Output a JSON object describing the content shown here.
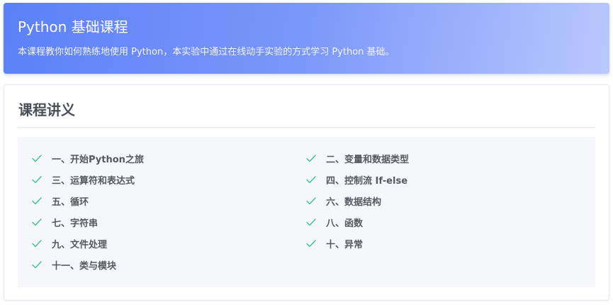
{
  "header": {
    "title": "Python 基础课程",
    "description": "本课程教你如何熟练地使用 Python，本实验中通过在线动手实验的方式学习 Python 基础。"
  },
  "section": {
    "title": "课程讲义"
  },
  "check_color": "#3cc28a",
  "lessons": [
    {
      "label": "一、开始Python之旅",
      "icon": "check-icon"
    },
    {
      "label": "二、变量和数据类型",
      "icon": "check-icon"
    },
    {
      "label": "三、运算符和表达式",
      "icon": "check-icon"
    },
    {
      "label": "四、控制流 If-else",
      "icon": "check-icon"
    },
    {
      "label": "五、循环",
      "icon": "check-icon"
    },
    {
      "label": "六、数据结构",
      "icon": "check-icon"
    },
    {
      "label": "七、字符串",
      "icon": "check-icon"
    },
    {
      "label": "八、函数",
      "icon": "check-icon"
    },
    {
      "label": "九、文件处理",
      "icon": "check-icon"
    },
    {
      "label": "十、异常",
      "icon": "check-icon"
    },
    {
      "label": "十一、类与模块",
      "icon": "check-icon"
    }
  ]
}
